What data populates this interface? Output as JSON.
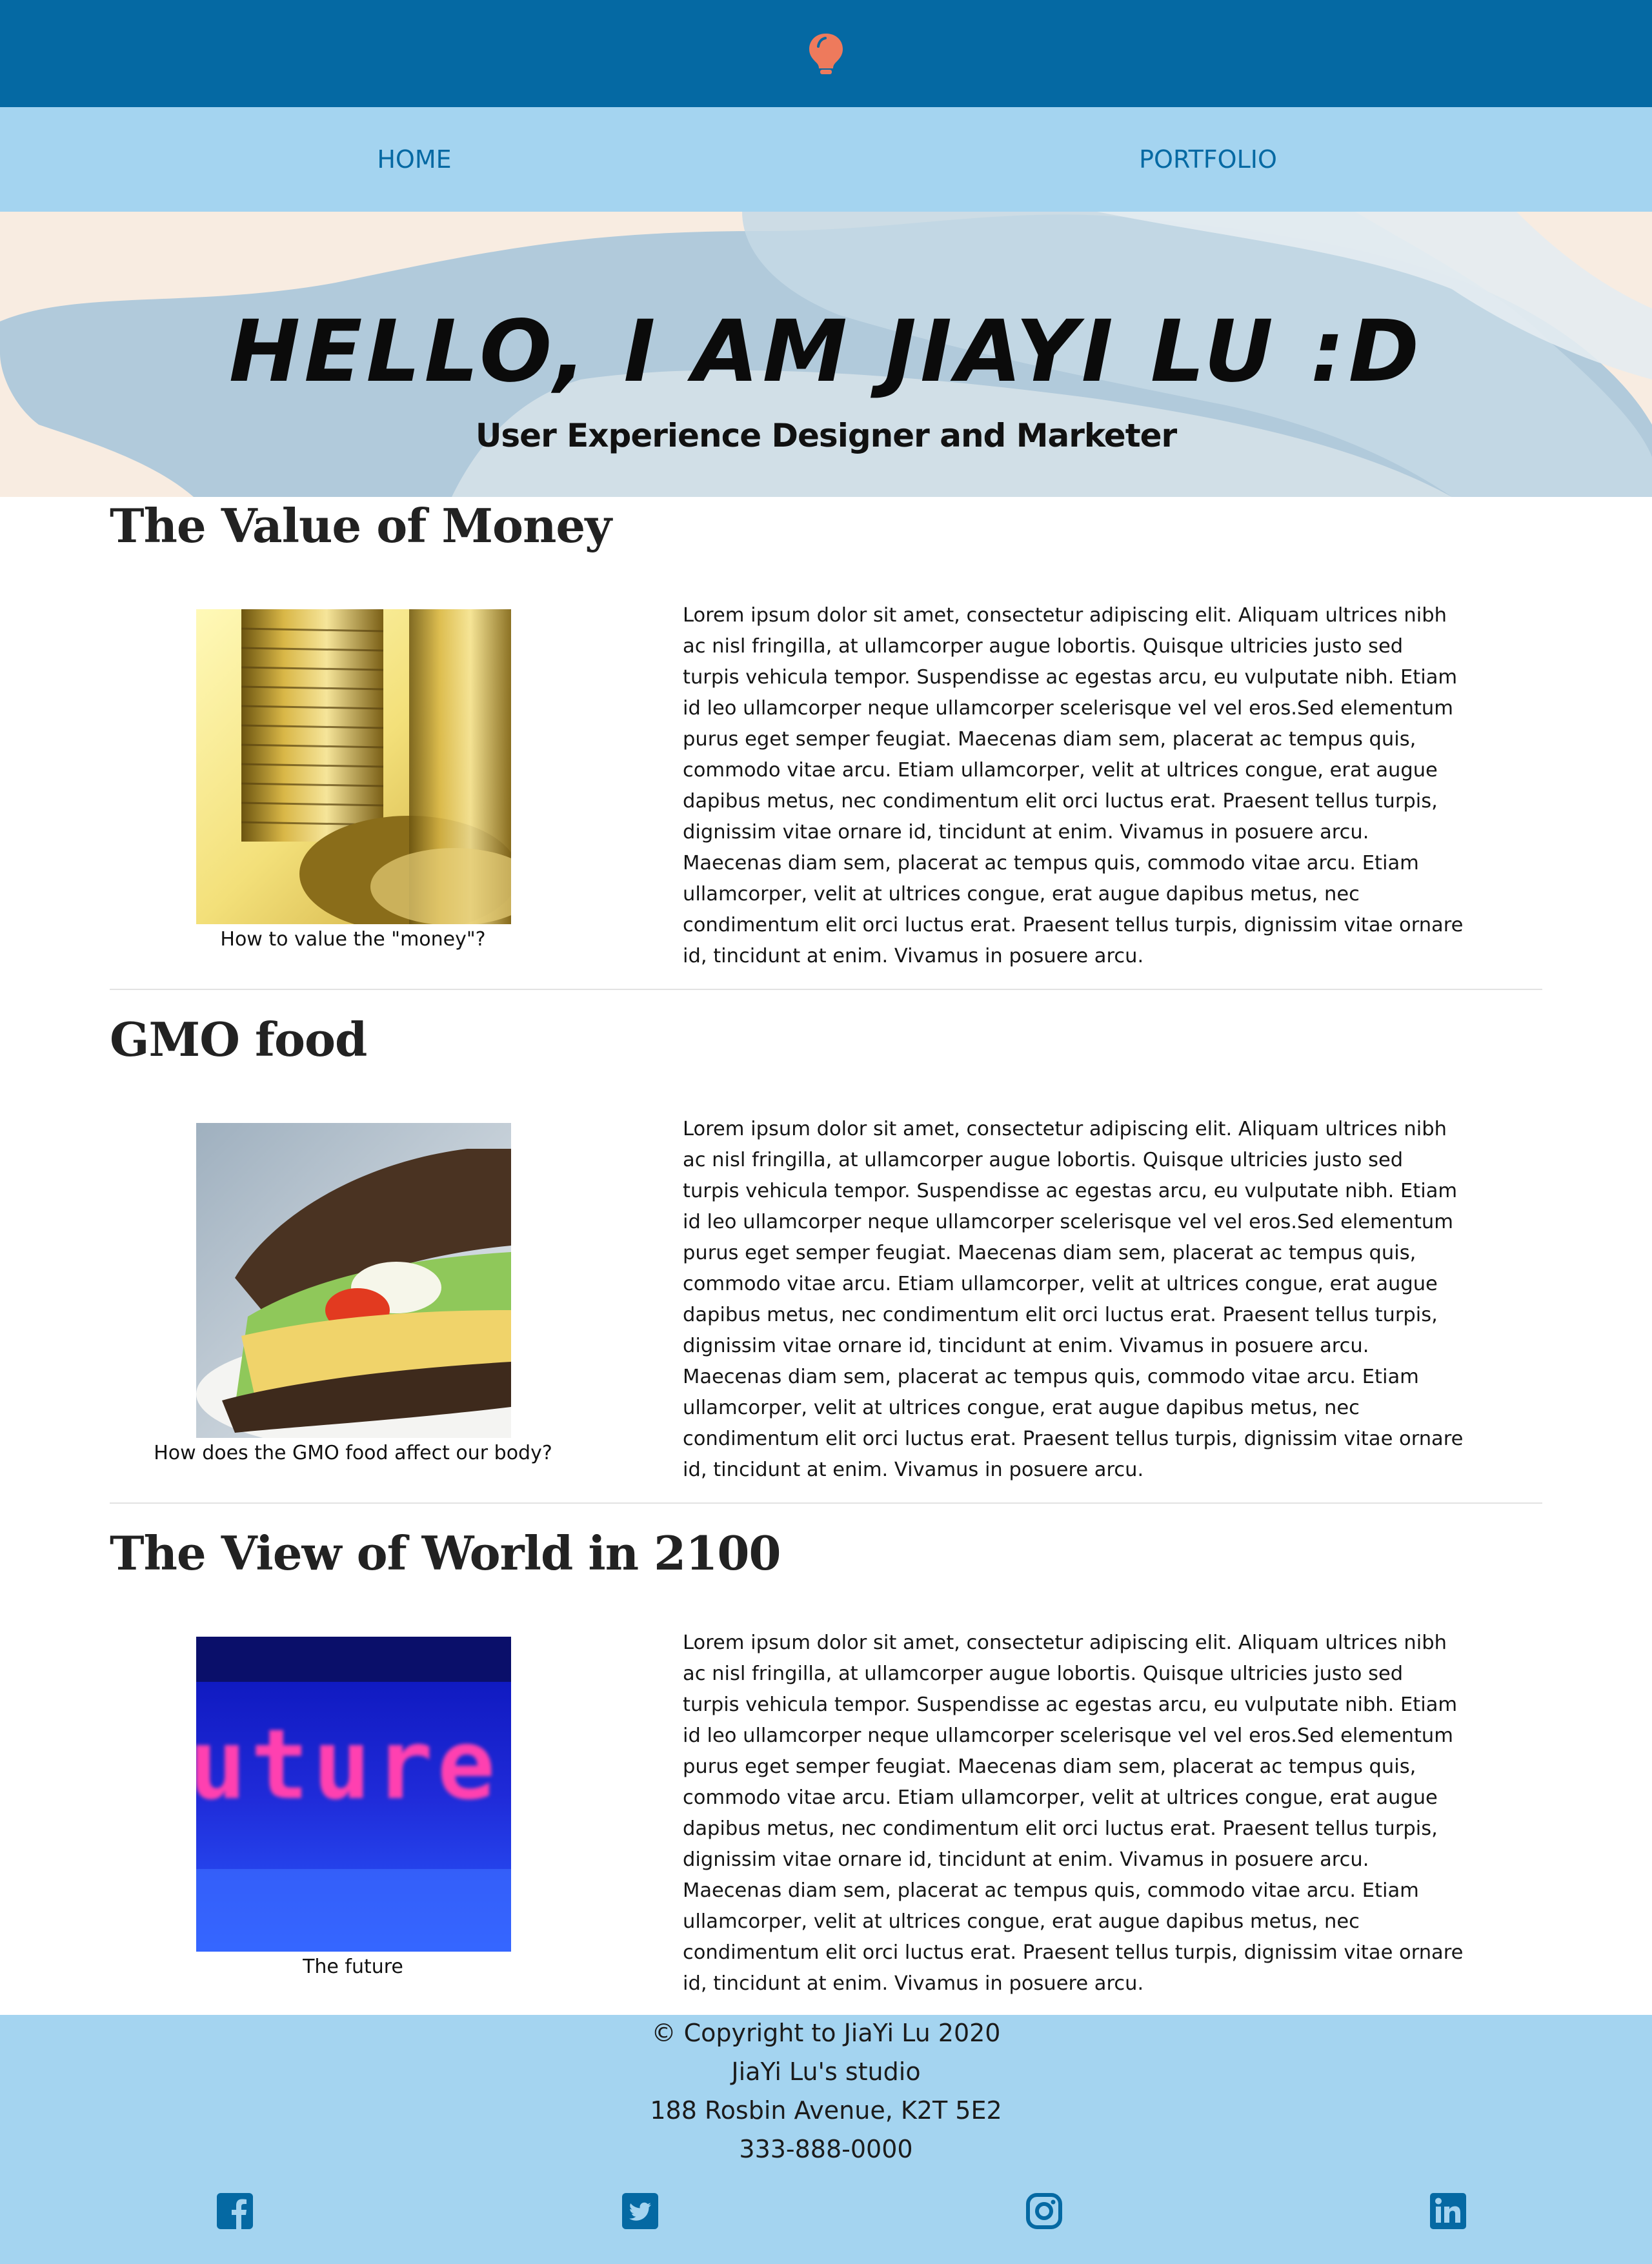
{
  "header": {
    "logo_icon": "lightbulb-icon",
    "colors": {
      "topbar": "#0569a3",
      "nav": "#a4d4f0",
      "bulb": "#ee7a5c"
    }
  },
  "nav": {
    "items": [
      {
        "label": "HOME"
      },
      {
        "label": "PORTFOLIO"
      }
    ]
  },
  "hero": {
    "title": "Hello, I am JiaYi Lu :D",
    "subtitle": "User Experience Designer and Marketer"
  },
  "articles": [
    {
      "title": "The Value of Money",
      "image": "gold-coins-image",
      "caption": "How to value the \"money\"?",
      "body": "Lorem ipsum dolor sit amet, consectetur adipiscing elit. Aliquam ultrices nibh ac nisl fringilla, at ullamcorper augue lobortis. Quisque ultricies justo sed turpis vehicula tempor. Suspendisse ac egestas arcu, eu vulputate nibh. Etiam id leo ullamcorper neque ullamcorper scelerisque vel vel eros.Sed elementum purus eget semper feugiat. Maecenas diam sem, placerat ac tempus quis, commodo vitae arcu. Etiam ullamcorper, velit at ultrices congue, erat augue dapibus metus, nec condimentum elit orci luctus erat. Praesent tellus turpis, dignissim vitae ornare id, tincidunt at enim. Vivamus in posuere arcu. Maecenas diam sem, placerat ac tempus quis, commodo vitae arcu. Etiam ullamcorper, velit at ultrices congue, erat augue dapibus metus, nec condimentum elit orci luctus erat. Praesent tellus turpis, dignissim vitae ornare id, tincidunt at enim. Vivamus in posuere arcu."
    },
    {
      "title": "GMO food",
      "image": "sandwich-image",
      "caption": "How does the GMO food affect our body?",
      "body": "Lorem ipsum dolor sit amet, consectetur adipiscing elit. Aliquam ultrices nibh ac nisl fringilla, at ullamcorper augue lobortis. Quisque ultricies justo sed turpis vehicula tempor. Suspendisse ac egestas arcu, eu vulputate nibh. Etiam id leo ullamcorper neque ullamcorper scelerisque vel vel eros.Sed elementum purus eget semper feugiat. Maecenas diam sem, placerat ac tempus quis, commodo vitae arcu. Etiam ullamcorper, velit at ultrices congue, erat augue dapibus metus, nec condimentum elit orci luctus erat. Praesent tellus turpis, dignissim vitae ornare id, tincidunt at enim. Vivamus in posuere arcu. Maecenas diam sem, placerat ac tempus quis, commodo vitae arcu. Etiam ullamcorper, velit at ultrices congue, erat augue dapibus metus, nec condimentum elit orci luctus erat. Praesent tellus turpis, dignissim vitae ornare id, tincidunt at enim. Vivamus in posuere arcu."
    },
    {
      "title": "The View of World in 2100",
      "image": "future-sign-image",
      "image_text": "uture",
      "caption": "The future",
      "body": "Lorem ipsum dolor sit amet, consectetur adipiscing elit. Aliquam ultrices nibh ac nisl fringilla, at ullamcorper augue lobortis. Quisque ultricies justo sed turpis vehicula tempor. Suspendisse ac egestas arcu, eu vulputate nibh. Etiam id leo ullamcorper neque ullamcorper scelerisque vel vel eros.Sed elementum purus eget semper feugiat. Maecenas diam sem, placerat ac tempus quis, commodo vitae arcu. Etiam ullamcorper, velit at ultrices congue, erat augue dapibus metus, nec condimentum elit orci luctus erat. Praesent tellus turpis, dignissim vitae ornare id, tincidunt at enim. Vivamus in posuere arcu. Maecenas diam sem, placerat ac tempus quis, commodo vitae arcu. Etiam ullamcorper, velit at ultrices congue, erat augue dapibus metus, nec condimentum elit orci luctus erat. Praesent tellus turpis, dignissim vitae ornare id, tincidunt at enim. Vivamus in posuere arcu."
    }
  ],
  "footer": {
    "copyright": "© Copyright to JiaYi Lu 2020",
    "studio": "JiaYi Lu's studio",
    "address": "188 Rosbin Avenue, K2T 5E2",
    "phone": "333-888-0000",
    "social_icons": [
      "facebook-icon",
      "twitter-icon",
      "instagram-icon",
      "linkedin-icon"
    ],
    "icon_color": "#0569a3"
  }
}
